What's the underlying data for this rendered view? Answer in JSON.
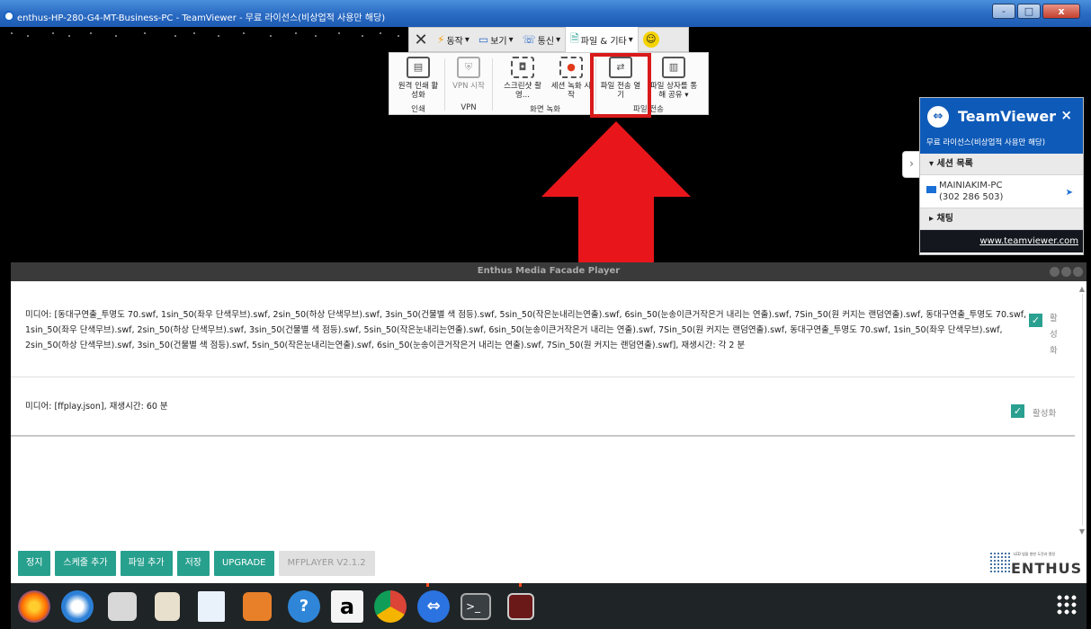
{
  "window": {
    "title": "enthus-HP-280-G4-MT-Business-PC - TeamViewer - 무료 라이선스(비상업적 사용만 해당)",
    "buttons": [
      "-",
      "□",
      "x"
    ]
  },
  "tv_toolbar": {
    "menus": [
      "동작",
      "보기",
      "통신",
      "파일 & 기타"
    ]
  },
  "tv_panel": {
    "items": [
      {
        "label": "원격 인쇄 활성화",
        "icon": "printer-icon"
      },
      {
        "label": "VPN 시작",
        "icon": "shield-icon"
      },
      {
        "label": "스크린샷 촬영...",
        "icon": "camera-icon"
      },
      {
        "label": "세션 녹화 시작",
        "icon": "record-icon"
      },
      {
        "label": "파일 전송 열기",
        "icon": "file-transfer-icon"
      },
      {
        "label": "파일 상자를 통해 공유 ▾",
        "icon": "file-box-icon"
      }
    ],
    "groups": [
      "인쇄",
      "VPN",
      "화면 녹화",
      "파일 전송"
    ]
  },
  "tv_side": {
    "brand": "TeamViewer",
    "close": "×",
    "license": "무료 라이선스(비상업적 사용만 해당)",
    "session_header": "▾  세션 목록",
    "session_name": "MAINIAKIM-PC",
    "session_id": "(302 286 503)",
    "chat": "▸  채팅",
    "link": "www.teamviewer.com",
    "expand": "›"
  },
  "app": {
    "title": "Enthus Media Facade Player",
    "media1": "미디어: [동대구연출_투명도 70.swf, 1sin_50(좌우 단색무브).swf, 2sin_50(하상 단색무브).swf, 3sin_50(건물별 색 점등).swf, 5sin_50(작은눈내리는연출).swf, 6sin_50(눈송이큰거작은거 내리는 연출).swf, 7Sin_50(원 커지는 랜덤연출).swf, 동대구연출_투명도 70.swf, 1sin_50(좌우 단색무브).swf, 2sin_50(하상 단색무브).swf, 3sin_50(건물별 색 점등).swf, 5sin_50(작은눈내리는연출).swf, 6sin_50(눈송이큰거작은거 내리는 연출).swf, 7Sin_50(원 커지는 랜덤연출).swf, 동대구연출_투명도 70.swf, 1sin_50(좌우 단색무브).swf, 2sin_50(하상 단색무브).swf, 3sin_50(건물별 색 점등).swf, 5sin_50(작은눈내리는연출).swf, 6sin_50(눈송이큰거작은거 내리는 연출).swf, 7Sin_50(원 커지는 랜덤연출).swf], 재생시간: 각 2 분",
    "media1_active": "활성화",
    "media2": "미디어: [ffplay.json], 재생시간: 60 분",
    "media2_active": "활성화",
    "buttons": [
      "정지",
      "스케줄 추가",
      "파일 추가",
      "저장",
      "UPGRADE"
    ],
    "version": "MFPLAYER V2.1.2",
    "logo_name": "ENTHUS",
    "logo_sub": "LED 빛을 향한 도전과 열정",
    "check": "✓"
  },
  "taskbar": {
    "apps": [
      "firefox-icon",
      "thunderbird-icon",
      "files-icon",
      "rhythmbox-icon",
      "libreoffice-writer-icon",
      "software-center-icon",
      "help-icon",
      "amazon-icon",
      "chrome-icon",
      "teamviewer-icon",
      "terminal-icon",
      "screen-recorder-icon"
    ],
    "help_glyph": "?",
    "amazon_glyph": "a",
    "terminal_glyph": ">_"
  },
  "colors": {
    "teal": "#28a08e",
    "teamviewer_blue": "#0e5ab8",
    "highlight_red": "#d91a1a"
  }
}
